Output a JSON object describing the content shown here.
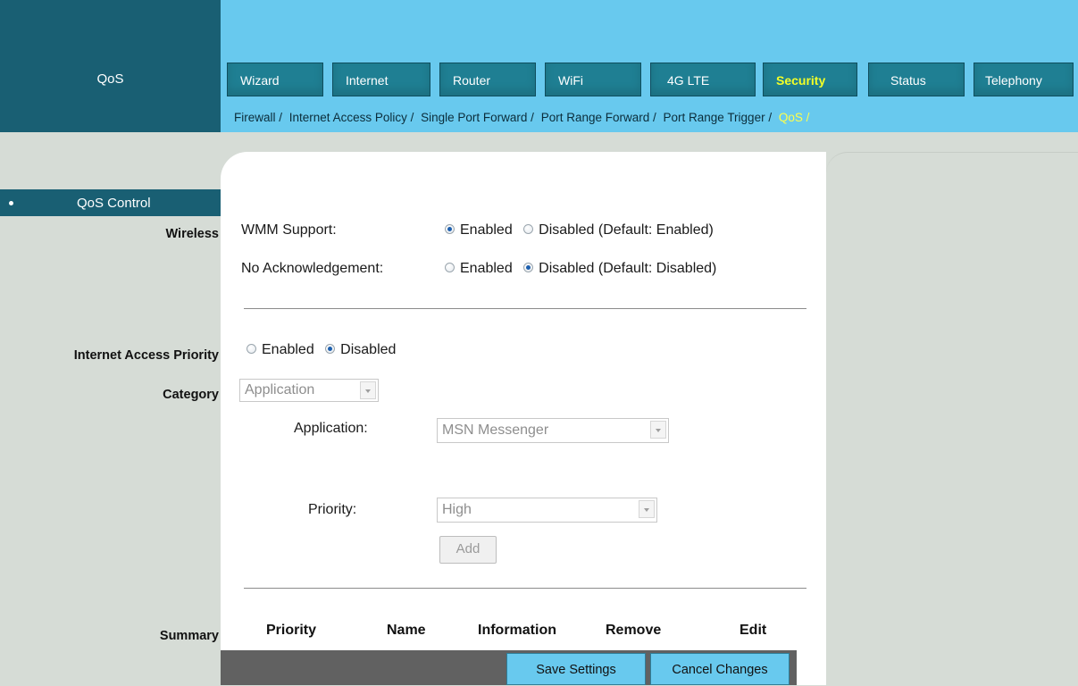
{
  "header": {
    "section_title": "QoS",
    "tabs": [
      {
        "label": "Wizard"
      },
      {
        "label": "Internet"
      },
      {
        "label": "Router"
      },
      {
        "label": "WiFi"
      },
      {
        "label": "4G LTE"
      },
      {
        "label": "Security",
        "active": true
      },
      {
        "label": "Status"
      },
      {
        "label": "Telephony"
      }
    ],
    "subnav": [
      {
        "label": "Firewall /"
      },
      {
        "label": "Internet Access Policy /"
      },
      {
        "label": "Single Port Forward /"
      },
      {
        "label": "Port Range Forward /"
      },
      {
        "label": "Port Range Trigger /"
      },
      {
        "label": "QoS /",
        "active": true
      }
    ]
  },
  "sidebar": {
    "control_label": "QoS Control",
    "labels": {
      "wireless": "Wireless",
      "internet_access_priority": "Internet Access Priority",
      "category": "Category",
      "summary": "Summary"
    }
  },
  "form": {
    "wmm": {
      "label": "WMM Support:",
      "enabled": "Enabled",
      "disabled": "Disabled (Default: Enabled)",
      "selected": "enabled"
    },
    "no_ack": {
      "label": "No Acknowledgement:",
      "enabled": "Enabled",
      "disabled": "Disabled (Default: Disabled)",
      "selected": "disabled"
    },
    "iap": {
      "enabled": "Enabled",
      "disabled": "Disabled",
      "selected": "disabled"
    },
    "category": {
      "value": "Application"
    },
    "application": {
      "label": "Application:",
      "value": "MSN Messenger"
    },
    "priority": {
      "label": "Priority:",
      "value": "High"
    },
    "add_button": "Add"
  },
  "summary": {
    "columns": [
      "Priority",
      "Name",
      "Information",
      "Remove",
      "Edit"
    ]
  },
  "footer": {
    "save": "Save Settings",
    "cancel": "Cancel Changes"
  },
  "colors": {
    "header_dark": "#195f73",
    "header_light": "#68c9ee",
    "tab": "#1f7f93",
    "active_tab_text": "#f3ff27",
    "radio_selected": "#1d5fae"
  }
}
